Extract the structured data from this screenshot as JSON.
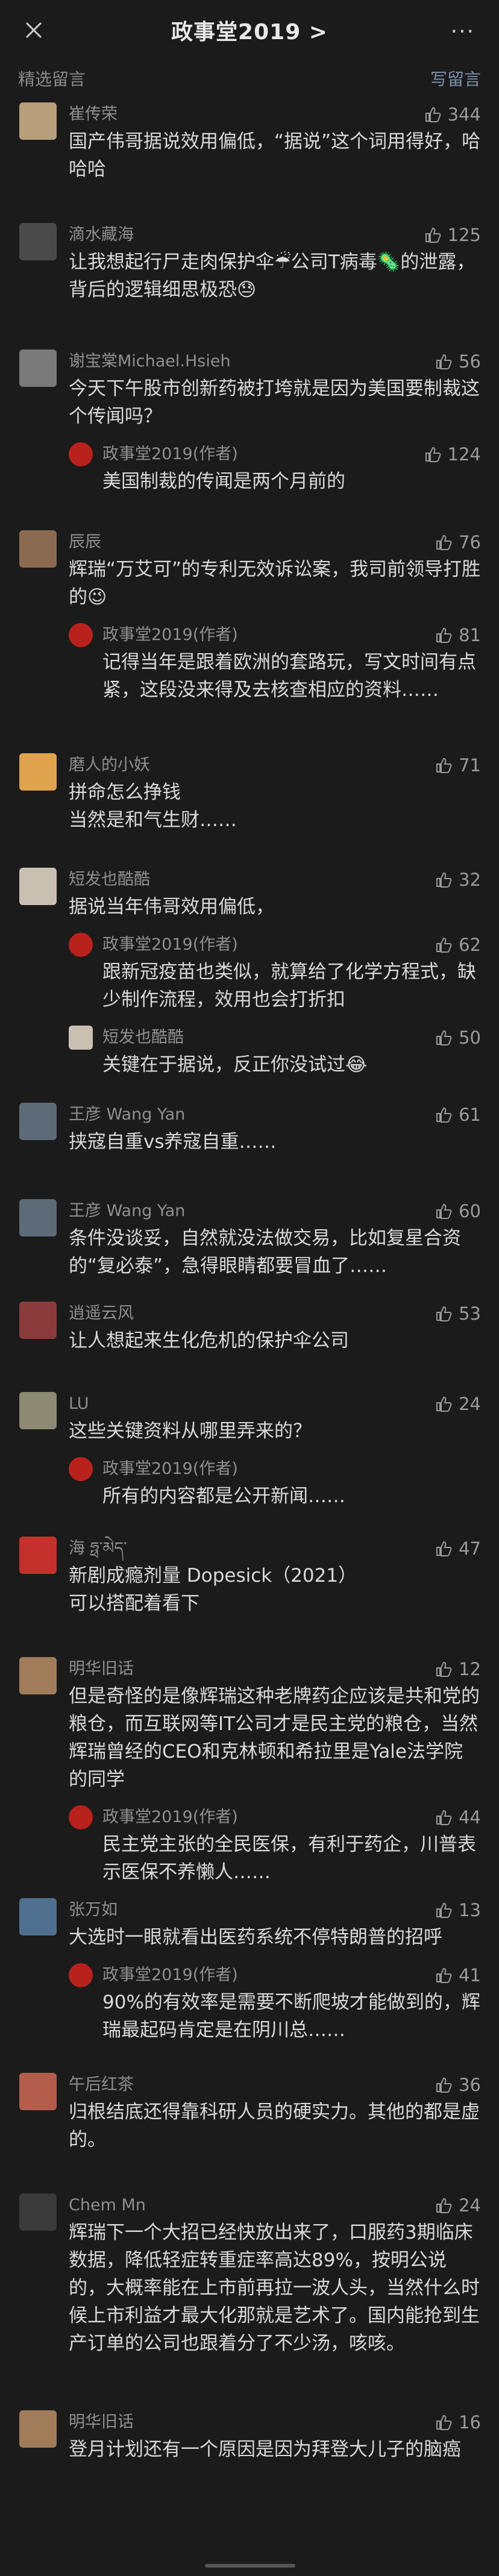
{
  "header": {
    "title": "政事堂2019 >",
    "more": "···"
  },
  "section": {
    "label": "精选留言",
    "write": "写留言"
  },
  "author_name": "政事堂2019(作者)",
  "comments": [
    {
      "user": "崔传荣",
      "likes": "344",
      "text": "国产伟哥据说效用偏低，“据说”这个词用得好，哈哈哈",
      "avatar_color": "#b89e7a"
    },
    {
      "user": "滴水藏海",
      "likes": "125",
      "text": "让我想起行尸走肉保护伞☔公司T病毒🦠的泄露，背后的逻辑细思极恐😓",
      "avatar_color": "#4a4a4a"
    },
    {
      "user": "谢宝棠Michael.Hsieh",
      "likes": "56",
      "text": "今天下午股市创新药被打垮就是因为美国要制裁这个传闻吗？",
      "reply": {
        "likes": "124",
        "text": "美国制裁的传闻是两个月前的"
      },
      "avatar_color": "#7a7a7a"
    },
    {
      "user": "辰辰",
      "likes": "76",
      "text": "辉瑞“万艾可”的专利无效诉讼案，我司前领导打胜的😉",
      "reply": {
        "likes": "81",
        "text": "记得当年是跟着欧洲的套路玩，写文时间有点紧，这段没来得及去核查相应的资料……"
      },
      "avatar_color": "#8a6b52"
    },
    {
      "user": "磨人的小妖",
      "likes": "71",
      "text": "拼命怎么挣钱\n当然是和气生财……",
      "avatar_color": "#e0a34d"
    },
    {
      "user": "短发也酷酷",
      "likes": "32",
      "text": "据说当年伟哥效用偏低，",
      "reply": {
        "likes": "62",
        "text": "跟新冠疫苗也类似，就算给了化学方程式，缺少制作流程，效用也会打折扣"
      },
      "reply2": {
        "user": "短发也酷酷",
        "likes": "50",
        "text": "关键在于据说，反正你没试过😂"
      },
      "avatar_color": "#c9c0b2"
    },
    {
      "user": "王彦 Wang Yan",
      "likes": "61",
      "text": "挟寇自重vs养寇自重……",
      "avatar_color": "#5d6b78"
    },
    {
      "user": "王彦 Wang Yan",
      "likes": "60",
      "text": "条件没谈妥，自然就没法做交易，比如复星合资的“复必泰”，急得眼睛都要冒血了……",
      "avatar_color": "#5d6b78"
    },
    {
      "user": "逍遥云风",
      "likes": "53",
      "text": "让人想起来生化危机的保护伞公司",
      "avatar_color": "#8b3b3b"
    },
    {
      "user": "LU",
      "likes": "24",
      "text": "这些关键资料从哪里弄来的？",
      "reply": {
        "likes": "",
        "text": "所有的内容都是公开新闻……"
      },
      "avatar_color": "#8c8a72"
    },
    {
      "user": "海 ཧྥ་མེད་",
      "likes": "47",
      "text": "新剧成瘾剂量 Dopesick（2021）\n可以搭配着看下",
      "avatar_color": "#c4302b"
    },
    {
      "user": "明华旧话",
      "likes": "12",
      "text": "但是奇怪的是像辉瑞这种老牌药企应该是共和党的粮仓，而互联网等IT公司才是民主党的粮仓，当然辉瑞曾经的CEO和克林顿和希拉里是Yale法学院的同学",
      "reply": {
        "likes": "44",
        "text": "民主党主张的全民医保，有利于药企，川普表示医保不养懒人……"
      },
      "avatar_color": "#a07c5b"
    },
    {
      "user": "张万如",
      "likes": "13",
      "text": "大选时一眼就看出医药系统不停特朗普的招呼",
      "reply": {
        "likes": "41",
        "text": "90%的有效率是需要不断爬坡才能做到的，辉瑞最起码肯定是在阴川总……"
      },
      "avatar_color": "#4f6f8f"
    },
    {
      "user": "午后红茶",
      "likes": "36",
      "text": "归根结底还得靠科研人员的硬实力。其他的都是虚的。",
      "avatar_color": "#b55d4c"
    },
    {
      "user": "Chem Mn",
      "likes": "24",
      "text": "辉瑞下一个大招已经快放出来了，口服药3期临床数据，降低轻症转重症率高达89%，按明公说的，大概率能在上市前再拉一波人头，当然什么时候上市利益才最大化那就是艺术了。国内能抢到生产订单的公司也跟着分了不少汤，咳咳。",
      "avatar_color": "#3a3a3a"
    },
    {
      "user": "明华旧话",
      "likes": "16",
      "text": "登月计划还有一个原因是因为拜登大儿子的脑癌",
      "avatar_color": "#a07c5b"
    }
  ]
}
